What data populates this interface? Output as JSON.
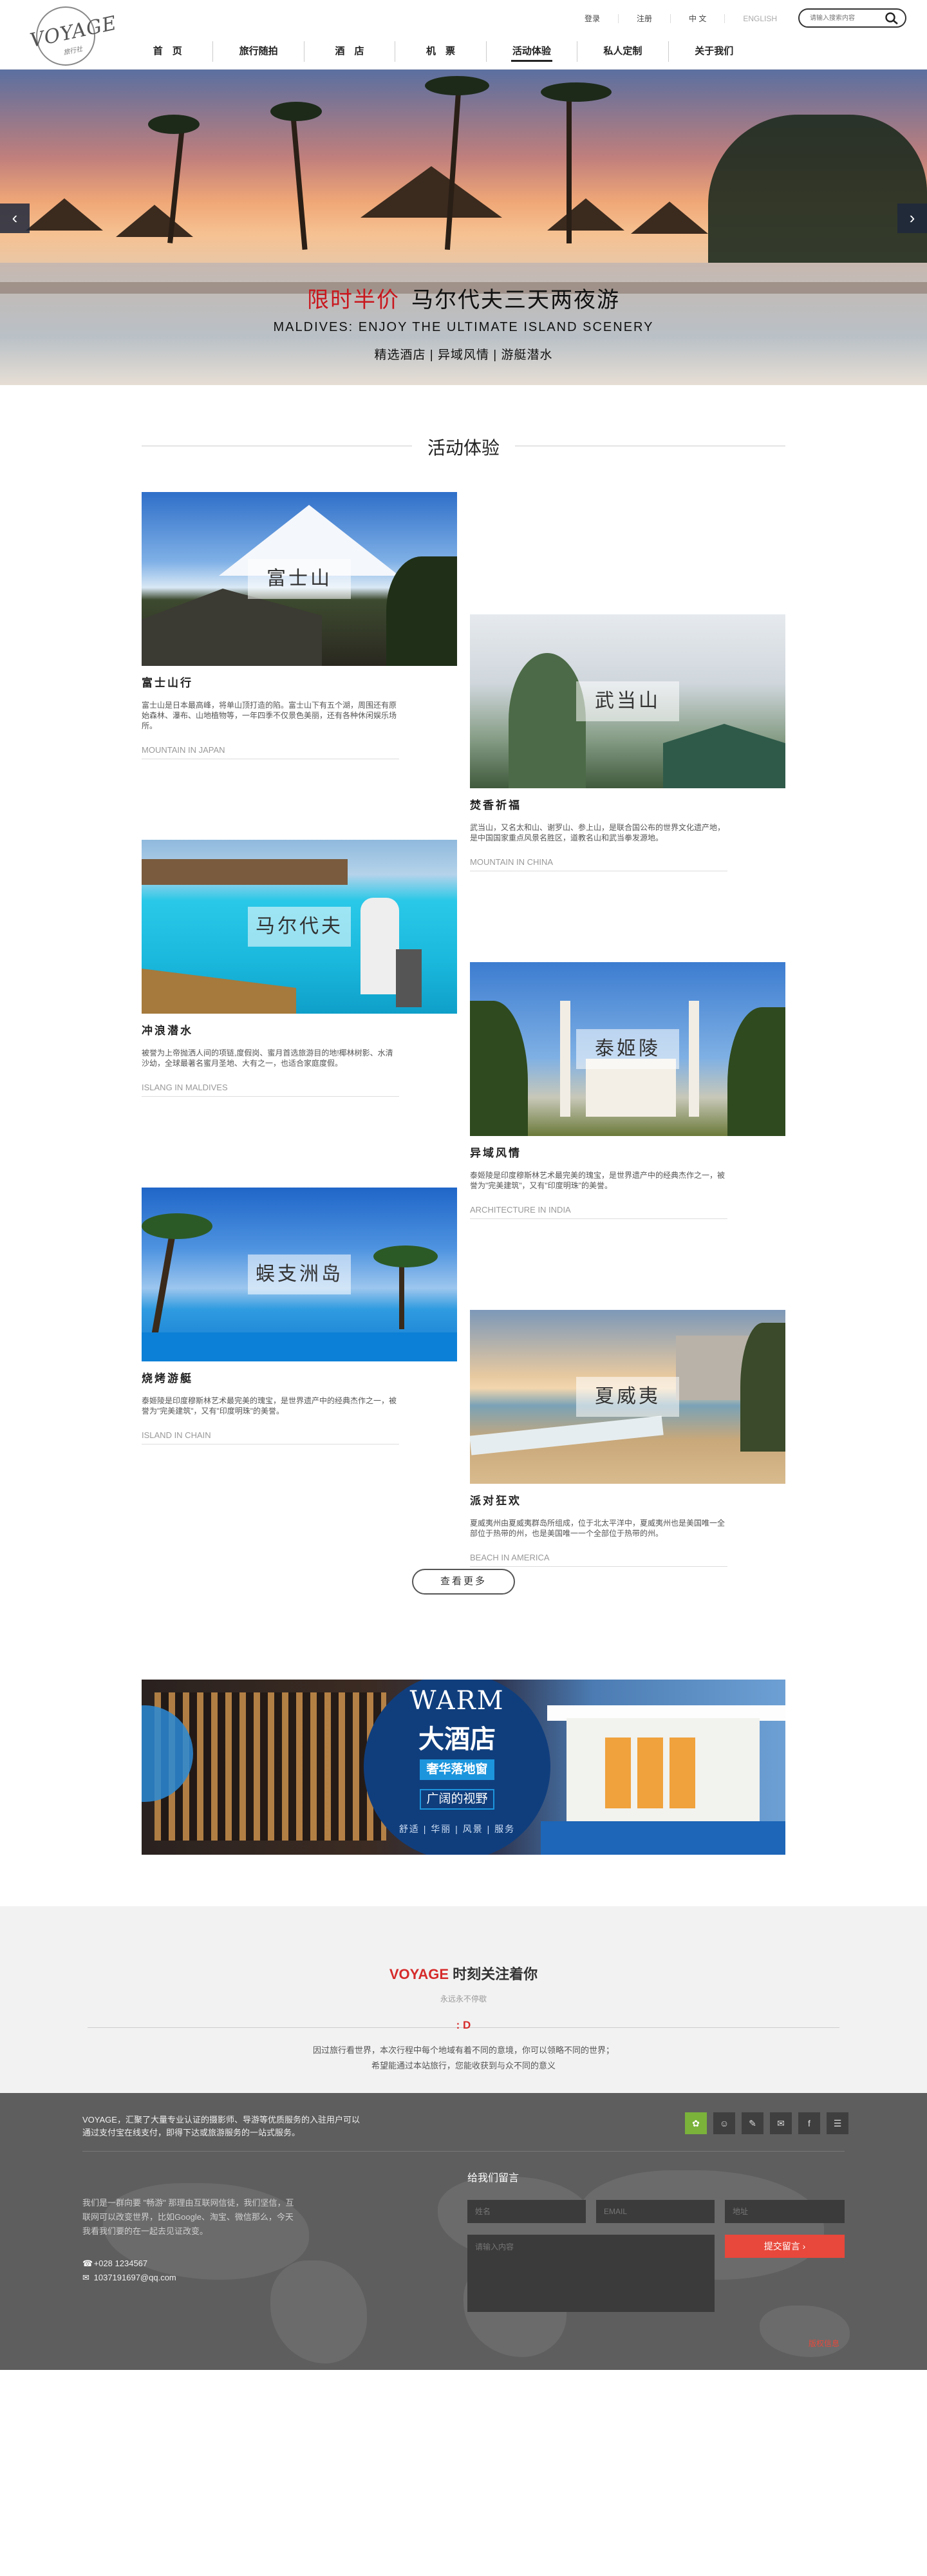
{
  "brand": {
    "logo_text": "VOYAGE",
    "logo_sub": "旅行社"
  },
  "toplinks": [
    "登录",
    "注册",
    "中 文",
    "ENGLISH"
  ],
  "search": {
    "placeholder": "请输入搜索内容"
  },
  "nav": [
    "首　页",
    "旅行随拍",
    "酒　店",
    "机　票",
    "活动体验",
    "私人定制",
    "关于我们"
  ],
  "hero": {
    "title_red": "限时半价",
    "title": "马尔代夫三天两夜游",
    "subtitle_en": "MALDIVES:   ENJOY THE ULTIMATE ISLAND SCENERY",
    "tagline": "精选酒店 | 异域风情 | 游艇潜水",
    "prev": "‹",
    "next": "›"
  },
  "section_title": "活动体验",
  "cards": [
    {
      "tag": "富士山",
      "title": "富士山行",
      "desc": "富士山是日本最高峰，将单山顶打造的陷。富士山下有五个湖，周围还有原始森林、瀑布、山地植物等，一年四季不仅景色美丽，还有各种休闲娱乐场所。",
      "loc": "MOUNTAIN IN JAPAN"
    },
    {
      "tag": "武当山",
      "title": "焚香祈福",
      "desc": "武当山，又名太和山、谢罗山、参上山，是联合国公布的世界文化遗产地，是中国国家重点风景名胜区，道教名山和武当拳发源地。",
      "loc": "MOUNTAIN IN CHINA"
    },
    {
      "tag": "马尔代夫",
      "title": "冲浪潜水",
      "desc": "被誉为上帝抛洒人间的项链,度假岗、蜜月首选旅游目的地!椰林树影、水清沙幼，全球最著名蜜月圣地、大有之一，也适合家庭度假。",
      "loc": "ISLANG IN MALDIVES"
    },
    {
      "tag": "泰姬陵",
      "title": "异域风情",
      "desc": "泰姬陵是印度穆斯林艺术最完美的瑰宝，是世界遗产中的经典杰作之一，被誉为\"完美建筑\"，又有\"印度明珠\"的美誉。",
      "loc": "ARCHITECTURE IN INDIA"
    },
    {
      "tag": "蜈支洲岛",
      "title": "烧烤游艇",
      "desc": "泰姬陵是印度穆斯林艺术最完美的瑰宝，是世界遗产中的经典杰作之一，被誉为\"完美建筑\"，又有\"印度明珠\"的美誉。",
      "loc": "ISLAND IN CHAIN"
    },
    {
      "tag": "夏威夷",
      "title": "派对狂欢",
      "desc": "夏威夷州由夏威夷群岛所组成，位于北太平洋中，夏威夷州也是美国唯一全部位于热带的州，也是美国唯一一个全部位于热带的州。",
      "loc": "BEACH IN AMERICA"
    }
  ],
  "more_button": "查看更多",
  "banner": {
    "warm": "WARM",
    "hotel": "大酒店",
    "tag1": "奢华落地窗",
    "tag2": "广阔的视野",
    "foot": "舒适 | 华丽 | 风景 | 服务"
  },
  "follow": {
    "title_red": "VOYAGE",
    "title": " 时刻关注着你",
    "sub": "永远永不停歇",
    "smile": ": D",
    "line1": "因过旅行看世界，本次行程中每个地域有着不同的意境，你可以领略不同的世界；",
    "line2": "希望能通过本站旅行，您能收获到与众不同的意义"
  },
  "footer": {
    "intro": "VOYAGE，汇聚了大量专业认证的摄影师、导游等优质服务的入驻用户可以通过支付宝在线支付，即得下达或旅游服务的一站式服务。",
    "links_text": "我们是一群向要 \"畅游\" 那理由互联网信徒，我们坚信，互联网可以改变世界，比如Google、淘宝、微信那么，今天我看我们要的在一起去见证改变。",
    "phone": "+028 1234567",
    "email": "1037191697@qq.com",
    "socials": [
      "✿",
      "☺",
      "✎",
      "✉",
      "f",
      "☰"
    ],
    "msg_title": "给我们留言",
    "name_ph": "姓名",
    "email_ph": "EMAIL",
    "addr_ph": "地址",
    "content_ph": "请输入内容",
    "submit": "提交留言  ›",
    "copyright": "版权信息"
  },
  "colors": {
    "accent_red": "#c8171e",
    "blue": "#1c95dd",
    "green": "#7ab23a",
    "footer_bg": "#5e5e5e"
  }
}
